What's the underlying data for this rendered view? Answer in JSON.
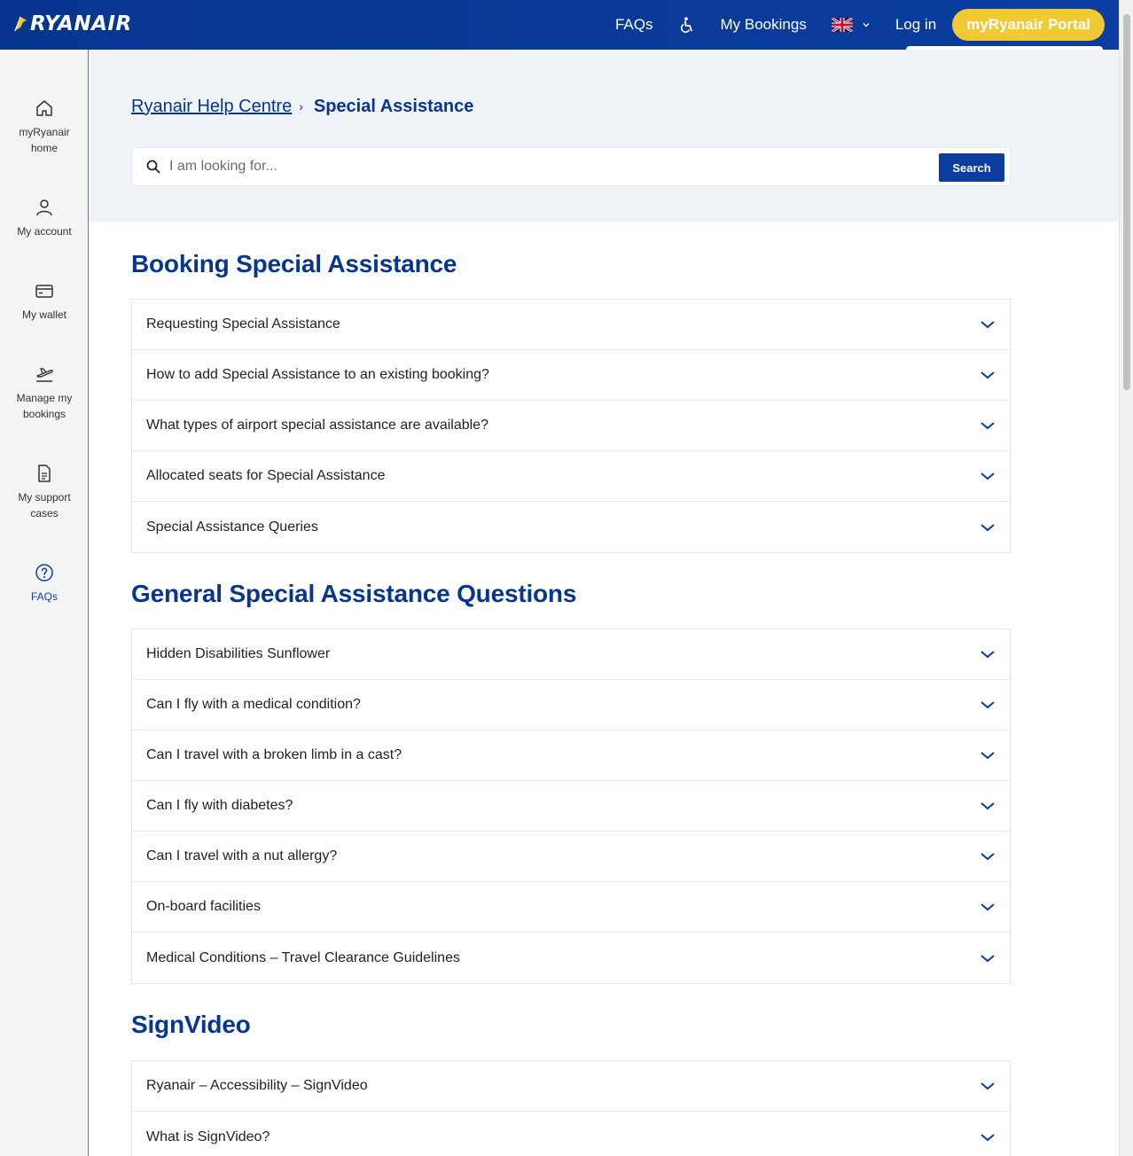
{
  "header": {
    "logo_text": "RYANAIR",
    "nav": {
      "faqs": "FAQs",
      "my_bookings": "My Bookings",
      "log_in": "Log in",
      "portal": "myRyanair Portal"
    },
    "icons": {
      "accessibility": "wheelchair-icon",
      "language": "uk-flag-icon"
    },
    "colors": {
      "brand_blue": "#073590",
      "accent_yellow": "#f1c933"
    }
  },
  "sidebar": {
    "items": [
      {
        "label": "myRyanair home",
        "icon": "home-icon"
      },
      {
        "label": "My account",
        "icon": "user-icon"
      },
      {
        "label": "My wallet",
        "icon": "wallet-icon"
      },
      {
        "label": "Manage my bookings",
        "icon": "plane-icon"
      },
      {
        "label": "My support cases",
        "icon": "document-icon"
      },
      {
        "label": "FAQs",
        "icon": "question-icon"
      }
    ]
  },
  "breadcrumb": {
    "root": "Ryanair Help Centre",
    "current": "Special Assistance"
  },
  "search": {
    "placeholder": "I am looking for...",
    "button": "Search"
  },
  "sections": [
    {
      "title": "Booking Special Assistance",
      "items": [
        "Requesting Special Assistance",
        "How to add Special Assistance to an existing booking?",
        "What types of airport special assistance are available?",
        "Allocated seats for Special Assistance",
        "Special Assistance Queries"
      ]
    },
    {
      "title": "General Special Assistance Questions",
      "items": [
        "Hidden Disabilities Sunflower",
        "Can I fly with a medical condition?",
        "Can I travel with a broken limb in a cast?",
        "Can I fly with diabetes?",
        "Can I travel with a nut allergy?",
        "On-board facilities",
        "Medical Conditions – Travel Clearance Guidelines"
      ]
    },
    {
      "title": "SignVideo",
      "items": [
        "Ryanair – Accessibility – SignVideo",
        "What is SignVideo?"
      ]
    }
  ]
}
